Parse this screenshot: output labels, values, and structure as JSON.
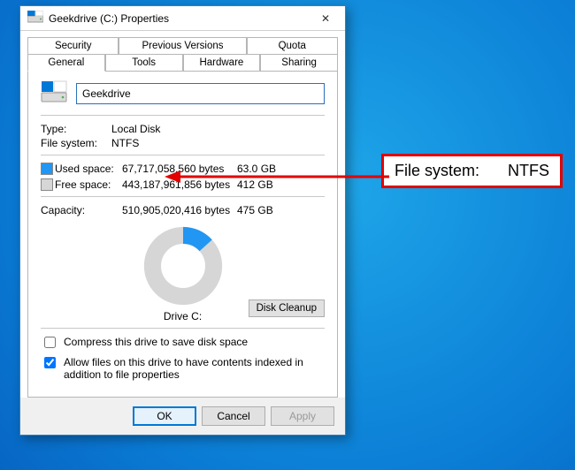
{
  "window": {
    "title": "Geekdrive (C:) Properties",
    "close_glyph": "✕"
  },
  "tabs": {
    "row1": [
      "Security",
      "Previous Versions",
      "Quota"
    ],
    "row2": [
      "General",
      "Tools",
      "Hardware",
      "Sharing"
    ],
    "active": "General"
  },
  "general": {
    "name_value": "Geekdrive",
    "type_label": "Type:",
    "type_value": "Local Disk",
    "fs_label": "File system:",
    "fs_value": "NTFS",
    "used_label": "Used space:",
    "used_bytes": "67,717,058,560 bytes",
    "used_human": "63.0 GB",
    "free_label": "Free space:",
    "free_bytes": "443,187,961,856 bytes",
    "free_human": "412 GB",
    "capacity_label": "Capacity:",
    "capacity_bytes": "510,905,020,416 bytes",
    "capacity_human": "475 GB",
    "drive_label": "Drive C:",
    "cleanup_label": "Disk Cleanup",
    "compress_label": "Compress this drive to save disk space",
    "index_label": "Allow files on this drive to have contents indexed in addition to file properties"
  },
  "buttons": {
    "ok": "OK",
    "cancel": "Cancel",
    "apply": "Apply"
  },
  "callout": {
    "label": "File system:",
    "value": "NTFS"
  },
  "chart_data": {
    "type": "pie",
    "title": "Drive C:",
    "series": [
      {
        "name": "Used space",
        "value": 63.0,
        "color": "#2196f3"
      },
      {
        "name": "Free space",
        "value": 412.0,
        "color": "#d6d6d6"
      }
    ],
    "units": "GB"
  }
}
